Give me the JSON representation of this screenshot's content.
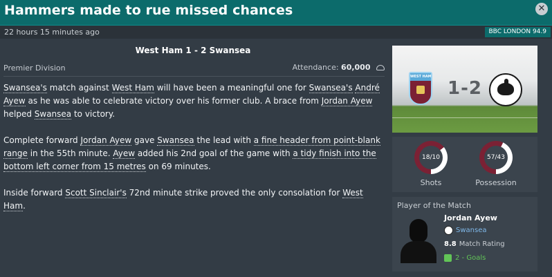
{
  "window": {
    "title": "Hammers made to rue missed chances",
    "close_icon": "close-icon"
  },
  "meta": {
    "time_ago": "22 hours 15 minutes ago",
    "source": "BBC LONDON 94.9"
  },
  "match": {
    "headline": "West Ham 1 - 2 Swansea",
    "division": "Premier Division",
    "attendance_label": "Attendance:",
    "attendance_value": "60,000",
    "score": "1-2",
    "home_crest_text": "WEST HAM UNITED"
  },
  "article": {
    "p1": [
      {
        "text": "Swansea's",
        "link": true
      },
      {
        "text": " match against ",
        "link": false
      },
      {
        "text": "West Ham",
        "link": true
      },
      {
        "text": " will have been a meaningful one for ",
        "link": false
      },
      {
        "text": "Swansea's",
        "link": true
      },
      {
        "text": " ",
        "link": false
      },
      {
        "text": "André Ayew",
        "link": true
      },
      {
        "text": " as he was able to celebrate victory over his former club. A brace from ",
        "link": false
      },
      {
        "text": "Jordan Ayew",
        "link": true
      },
      {
        "text": " helped ",
        "link": false
      },
      {
        "text": "Swansea",
        "link": true
      },
      {
        "text": " to victory.",
        "link": false
      }
    ],
    "p2": [
      {
        "text": "Complete forward ",
        "link": false
      },
      {
        "text": "Jordan Ayew",
        "link": true
      },
      {
        "text": " gave ",
        "link": false
      },
      {
        "text": "Swansea",
        "link": true
      },
      {
        "text": " the lead with ",
        "link": false
      },
      {
        "text": "a fine header from point-blank range",
        "link": true
      },
      {
        "text": " in the 55th minute. ",
        "link": false
      },
      {
        "text": "Ayew",
        "link": true
      },
      {
        "text": " added his 2nd goal of the game with ",
        "link": false
      },
      {
        "text": "a tidy finish into the bottom left corner from 15 metres",
        "link": true
      },
      {
        "text": " on 69 minutes.",
        "link": false
      }
    ],
    "p3": [
      {
        "text": "Inside forward ",
        "link": false
      },
      {
        "text": "Scott Sinclair's",
        "link": true
      },
      {
        "text": " 72nd minute strike proved the only consolation for ",
        "link": false
      },
      {
        "text": "West Ham",
        "link": true
      },
      {
        "text": ".",
        "link": false
      }
    ]
  },
  "stats": [
    {
      "label": "Shots",
      "value": "18/10",
      "home": 18,
      "away": 10,
      "home_color": "#7b2134",
      "away_color": "#ffffff"
    },
    {
      "label": "Possession",
      "value": "57/43",
      "home": 57,
      "away": 43,
      "home_color": "#7b2134",
      "away_color": "#ffffff"
    }
  ],
  "potm": {
    "header": "Player of the Match",
    "name": "Jordan Ayew",
    "club": "Swansea",
    "rating_value": "8.8",
    "rating_label": "Match Rating",
    "goals": "2 - Goals"
  }
}
